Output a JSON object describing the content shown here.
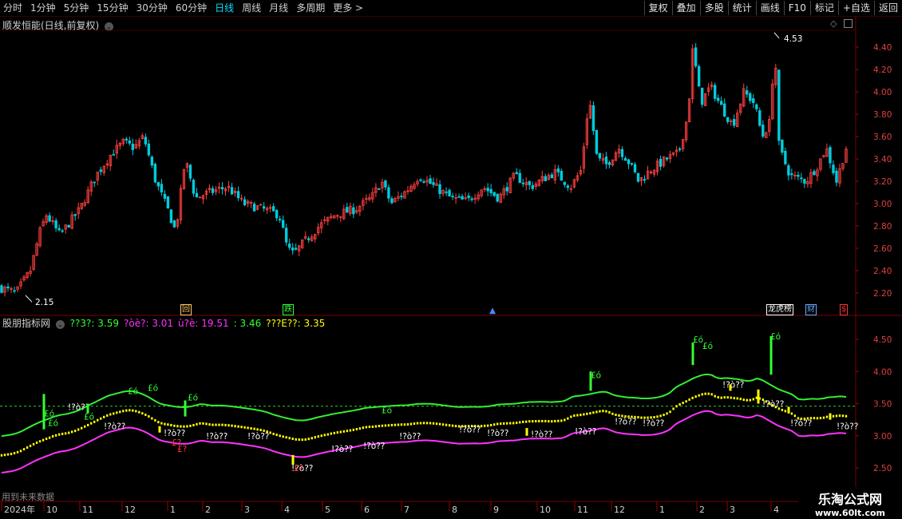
{
  "toolbar": {
    "tabs": [
      "分时",
      "1分钟",
      "5分钟",
      "15分钟",
      "30分钟",
      "60分钟",
      "日线",
      "周线",
      "月线",
      "多周期",
      "更多 >"
    ],
    "active_tab": "日线",
    "buttons": [
      "复权",
      "叠加",
      "多股",
      "统计",
      "画线",
      "F10",
      "标记",
      "+自选",
      "返回"
    ]
  },
  "main_panel": {
    "title": "顺发恒能(日线,前复权)",
    "y_ticks": [
      "4.40",
      "4.20",
      "4.00",
      "3.80",
      "3.60",
      "3.40",
      "3.20",
      "3.00",
      "2.80",
      "2.60",
      "2.40",
      "2.20"
    ],
    "high_label": "4.53",
    "low_label": "2.15",
    "markers": [
      {
        "text": "回",
        "color": "#ffcc66"
      },
      {
        "text": "跌",
        "color": "#33ff33"
      },
      {
        "text": "龙虎榜",
        "color": "#ffffff"
      },
      {
        "text": "财",
        "color": "#66aaff"
      },
      {
        "text": "$",
        "color": "#ff3333"
      }
    ]
  },
  "indicator_panel": {
    "title": "股朋指标网",
    "values": [
      {
        "label": "??3?:",
        "value": "3.59",
        "color": "#33ff33"
      },
      {
        "label": "?òè?:",
        "value": "3.01",
        "color": "#ff33ff"
      },
      {
        "label": "ù?è:",
        "value": "19.51",
        "color": "#ff33ff"
      },
      {
        "label": ":",
        "value": "3.46",
        "color": "#33ff33"
      },
      {
        "label": "???E??:",
        "value": "3.35",
        "color": "#ffff00"
      }
    ],
    "y_ticks": [
      "4.50",
      "4.00",
      "3.50",
      "3.00",
      "2.50"
    ],
    "annotation_yellow": "!?ò??",
    "annotation_green": "£ó",
    "annotation_red": "£?"
  },
  "date_axis": [
    "2024年",
    "10",
    "11",
    "12",
    "1",
    "2",
    "3",
    "4",
    "5",
    "6",
    "7",
    "8",
    "9",
    "10",
    "11",
    "12",
    "1",
    "2",
    "3",
    "4"
  ],
  "bottom_text": "用到未来数据",
  "watermark": {
    "line1": "乐淘公式网",
    "line2": "www.60lt.com"
  },
  "chart_data": {
    "type": "candlestick",
    "title": "顺发恒能(日线,前复权)",
    "ylim": [
      2.1,
      4.6
    ],
    "high": 4.53,
    "low": 2.15,
    "x_ticks": [
      "2024年",
      "10",
      "11",
      "12",
      "1",
      "2",
      "3",
      "4",
      "5",
      "6",
      "7",
      "8",
      "9",
      "10",
      "11",
      "12",
      "1",
      "2",
      "3",
      "4"
    ],
    "close_path": [
      [
        0,
        2.25
      ],
      [
        20,
        2.2
      ],
      [
        38,
        2.4
      ],
      [
        50,
        2.75
      ],
      [
        58,
        2.9
      ],
      [
        75,
        2.72
      ],
      [
        100,
        2.95
      ],
      [
        120,
        3.25
      ],
      [
        140,
        3.45
      ],
      [
        155,
        3.55
      ],
      [
        168,
        3.5
      ],
      [
        180,
        3.6
      ],
      [
        195,
        3.2
      ],
      [
        210,
        2.95
      ],
      [
        220,
        2.75
      ],
      [
        232,
        3.4
      ],
      [
        245,
        3.05
      ],
      [
        262,
        3.1
      ],
      [
        285,
        3.15
      ],
      [
        305,
        3.0
      ],
      [
        330,
        2.95
      ],
      [
        350,
        2.9
      ],
      [
        360,
        2.6
      ],
      [
        368,
        2.55
      ],
      [
        380,
        2.65
      ],
      [
        400,
        2.8
      ],
      [
        420,
        2.9
      ],
      [
        445,
        2.95
      ],
      [
        465,
        3.05
      ],
      [
        478,
        3.2
      ],
      [
        490,
        3.0
      ],
      [
        510,
        3.12
      ],
      [
        525,
        3.25
      ],
      [
        545,
        3.15
      ],
      [
        565,
        3.05
      ],
      [
        585,
        3.02
      ],
      [
        605,
        3.15
      ],
      [
        625,
        3.05
      ],
      [
        645,
        3.25
      ],
      [
        665,
        3.15
      ],
      [
        680,
        3.22
      ],
      [
        695,
        3.28
      ],
      [
        715,
        3.15
      ],
      [
        728,
        3.3
      ],
      [
        738,
        3.95
      ],
      [
        748,
        3.4
      ],
      [
        760,
        3.35
      ],
      [
        775,
        3.5
      ],
      [
        790,
        3.35
      ],
      [
        800,
        3.2
      ],
      [
        815,
        3.3
      ],
      [
        835,
        3.4
      ],
      [
        850,
        3.45
      ],
      [
        862,
        3.8
      ],
      [
        868,
        4.4
      ],
      [
        878,
        3.9
      ],
      [
        890,
        4.05
      ],
      [
        905,
        3.85
      ],
      [
        918,
        3.7
      ],
      [
        932,
        4.0
      ],
      [
        945,
        3.9
      ],
      [
        955,
        3.6
      ],
      [
        966,
        3.75
      ],
      [
        970,
        4.53
      ],
      [
        976,
        3.5
      ],
      [
        990,
        3.25
      ],
      [
        1010,
        3.2
      ],
      [
        1025,
        3.35
      ],
      [
        1035,
        3.5
      ],
      [
        1048,
        3.2
      ],
      [
        1062,
        3.55
      ]
    ],
    "indicator_series": [
      {
        "name": "??3?",
        "color": "#33ee33",
        "last": 3.59
      },
      {
        "name": "?òè?",
        "color": "#ff33ff",
        "last": 3.01
      },
      {
        "name": "???E??",
        "color": "#ffff00",
        "last": 3.35
      }
    ],
    "reference_line": 3.46
  }
}
